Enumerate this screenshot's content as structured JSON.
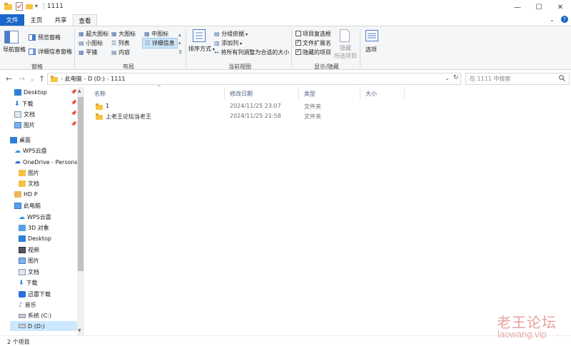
{
  "window": {
    "title": "1111",
    "minimize": "—",
    "maximize": "☐",
    "close": "✕"
  },
  "ribbon_tabs": [
    "文件",
    "主页",
    "共享",
    "查看"
  ],
  "ribbon": {
    "panes": {
      "nav_pane": "导航窗格",
      "preview_pane": "预览窗格",
      "details_pane": "详细信息窗格",
      "group": "窗格"
    },
    "layout": {
      "items": [
        "超大图标",
        "大图标",
        "中图标",
        "小图标",
        "列表",
        "详细信息",
        "平铺",
        "内容"
      ],
      "selected": "详细信息",
      "group": "布局"
    },
    "current_view": {
      "sort": "排序方式",
      "group_by": "分组依据",
      "add_column": "添加列",
      "fit_columns": "将所有列调整为合适的大小",
      "group": "当前视图"
    },
    "show_hide": {
      "item_checkboxes": "项目复选框",
      "file_ext": "文件扩展名",
      "hidden_items": "隐藏的项目",
      "hide_selected_1": "隐藏",
      "hide_selected_2": "所选项目",
      "group": "显示/隐藏",
      "checked": {
        "item_checkboxes": false,
        "file_ext": true,
        "hidden_items": true
      }
    },
    "options": "选项"
  },
  "address": {
    "crumbs": [
      "此电脑",
      "D (D:)",
      "1111"
    ],
    "search_placeholder": "在 1111 中搜索"
  },
  "nav_pane": {
    "quick_access": [
      {
        "label": "Desktop",
        "pinned": true
      },
      {
        "label": "下载",
        "pinned": true
      },
      {
        "label": "文档",
        "pinned": true
      },
      {
        "label": "图片",
        "pinned": true
      }
    ],
    "items": [
      "桌面",
      "WPS云盘",
      "OneDrive - Personal",
      "图片",
      "文档",
      "HD P",
      "此电脑",
      "WPS云盘",
      "3D 对象",
      "Desktop",
      "视频",
      "图片",
      "文档",
      "下载",
      "迅雷下载",
      "音乐",
      "系统 (C:)",
      "D (D:)"
    ],
    "selected": "D (D:)"
  },
  "columns": {
    "name": "名称",
    "date": "修改日期",
    "type": "类型",
    "size": "大小"
  },
  "files": [
    {
      "name": "1",
      "date": "2024/11/25 23:07",
      "type": "文件夹",
      "size": ""
    },
    {
      "name": "上老王论坛当老王",
      "date": "2024/11/25 21:58",
      "type": "文件夹",
      "size": ""
    }
  ],
  "status": {
    "count": "2 个项目"
  },
  "watermark": {
    "line1": "老王论坛",
    "line2": "laowang.vip"
  },
  "colors": {
    "accent": "#1a67c9",
    "folder": "#f5c344",
    "selection": "#cce8ff"
  }
}
